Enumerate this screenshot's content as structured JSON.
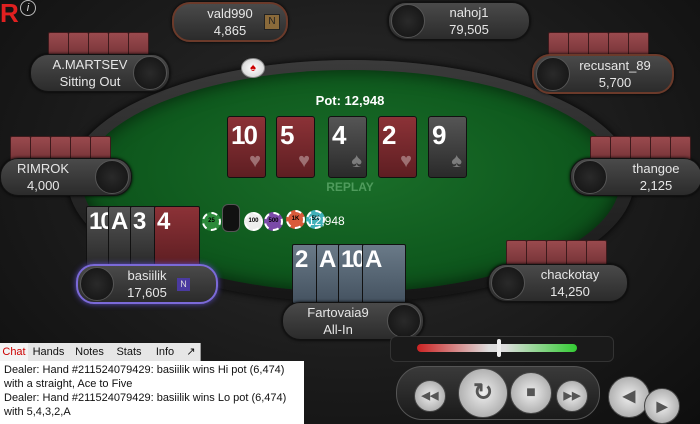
{
  "table": {
    "pot_label": "Pot: 12,948",
    "center_pot": "12,948",
    "replay_label": "REPLAY"
  },
  "board": [
    {
      "rank": "10",
      "suit": "hearts",
      "color": "#8c3237"
    },
    {
      "rank": "5",
      "suit": "hearts",
      "color": "#8c3237"
    },
    {
      "rank": "4",
      "suit": "spades",
      "color": "#3a3a3a"
    },
    {
      "rank": "2",
      "suit": "hearts",
      "color": "#8c3237"
    },
    {
      "rank": "9",
      "suit": "spades",
      "color": "#3a3a3a"
    }
  ],
  "seats": {
    "vald990": {
      "name": "vald990",
      "stack": "4,865",
      "badge": "N"
    },
    "nahoj1": {
      "name": "nahoj1",
      "stack": "79,505"
    },
    "amartsev": {
      "name": "A.MARTSEV",
      "status": "Sitting Out"
    },
    "recusant": {
      "name": "recusant_89",
      "stack": "5,700"
    },
    "rimrok": {
      "name": "RIMROK",
      "stack": "4,000"
    },
    "thangoe": {
      "name": "thangoe",
      "stack": "2,125"
    },
    "basiilik": {
      "name": "basiilik",
      "stack": "17,605",
      "badge": "N",
      "cards": [
        "10",
        "A",
        "3",
        "4"
      ]
    },
    "chackotay": {
      "name": "chackotay",
      "stack": "14,250"
    },
    "fartovaia": {
      "name": "Fartovaia9",
      "status": "All-In",
      "cards": [
        "2",
        "A",
        "10",
        "A"
      ]
    }
  },
  "chips": [
    "25",
    "100",
    "500",
    "1K",
    "5K"
  ],
  "chat": {
    "tabs": [
      "Chat",
      "Hands",
      "Notes",
      "Stats",
      "Info",
      "↗"
    ],
    "lines": [
      "Dealer: Hand #211524079429: basiilik wins Hi pot (6,474) with a straight, Ace to Five",
      "Dealer: Hand #211524079429: basiilik wins Lo pot (6,474) with 5,4,3,2,A"
    ]
  },
  "logo_text": "R",
  "info_icon": "i",
  "controls": {
    "rewind": "◀◀",
    "replay": "↻",
    "stop": "■",
    "forward": "▶▶",
    "back": "◀",
    "next": "▶"
  },
  "colors": {
    "felt": "#0f5a1e",
    "heart_card": "#8c3237",
    "spade_card": "#3a3a3a",
    "highlight": "#7b6ad8"
  }
}
